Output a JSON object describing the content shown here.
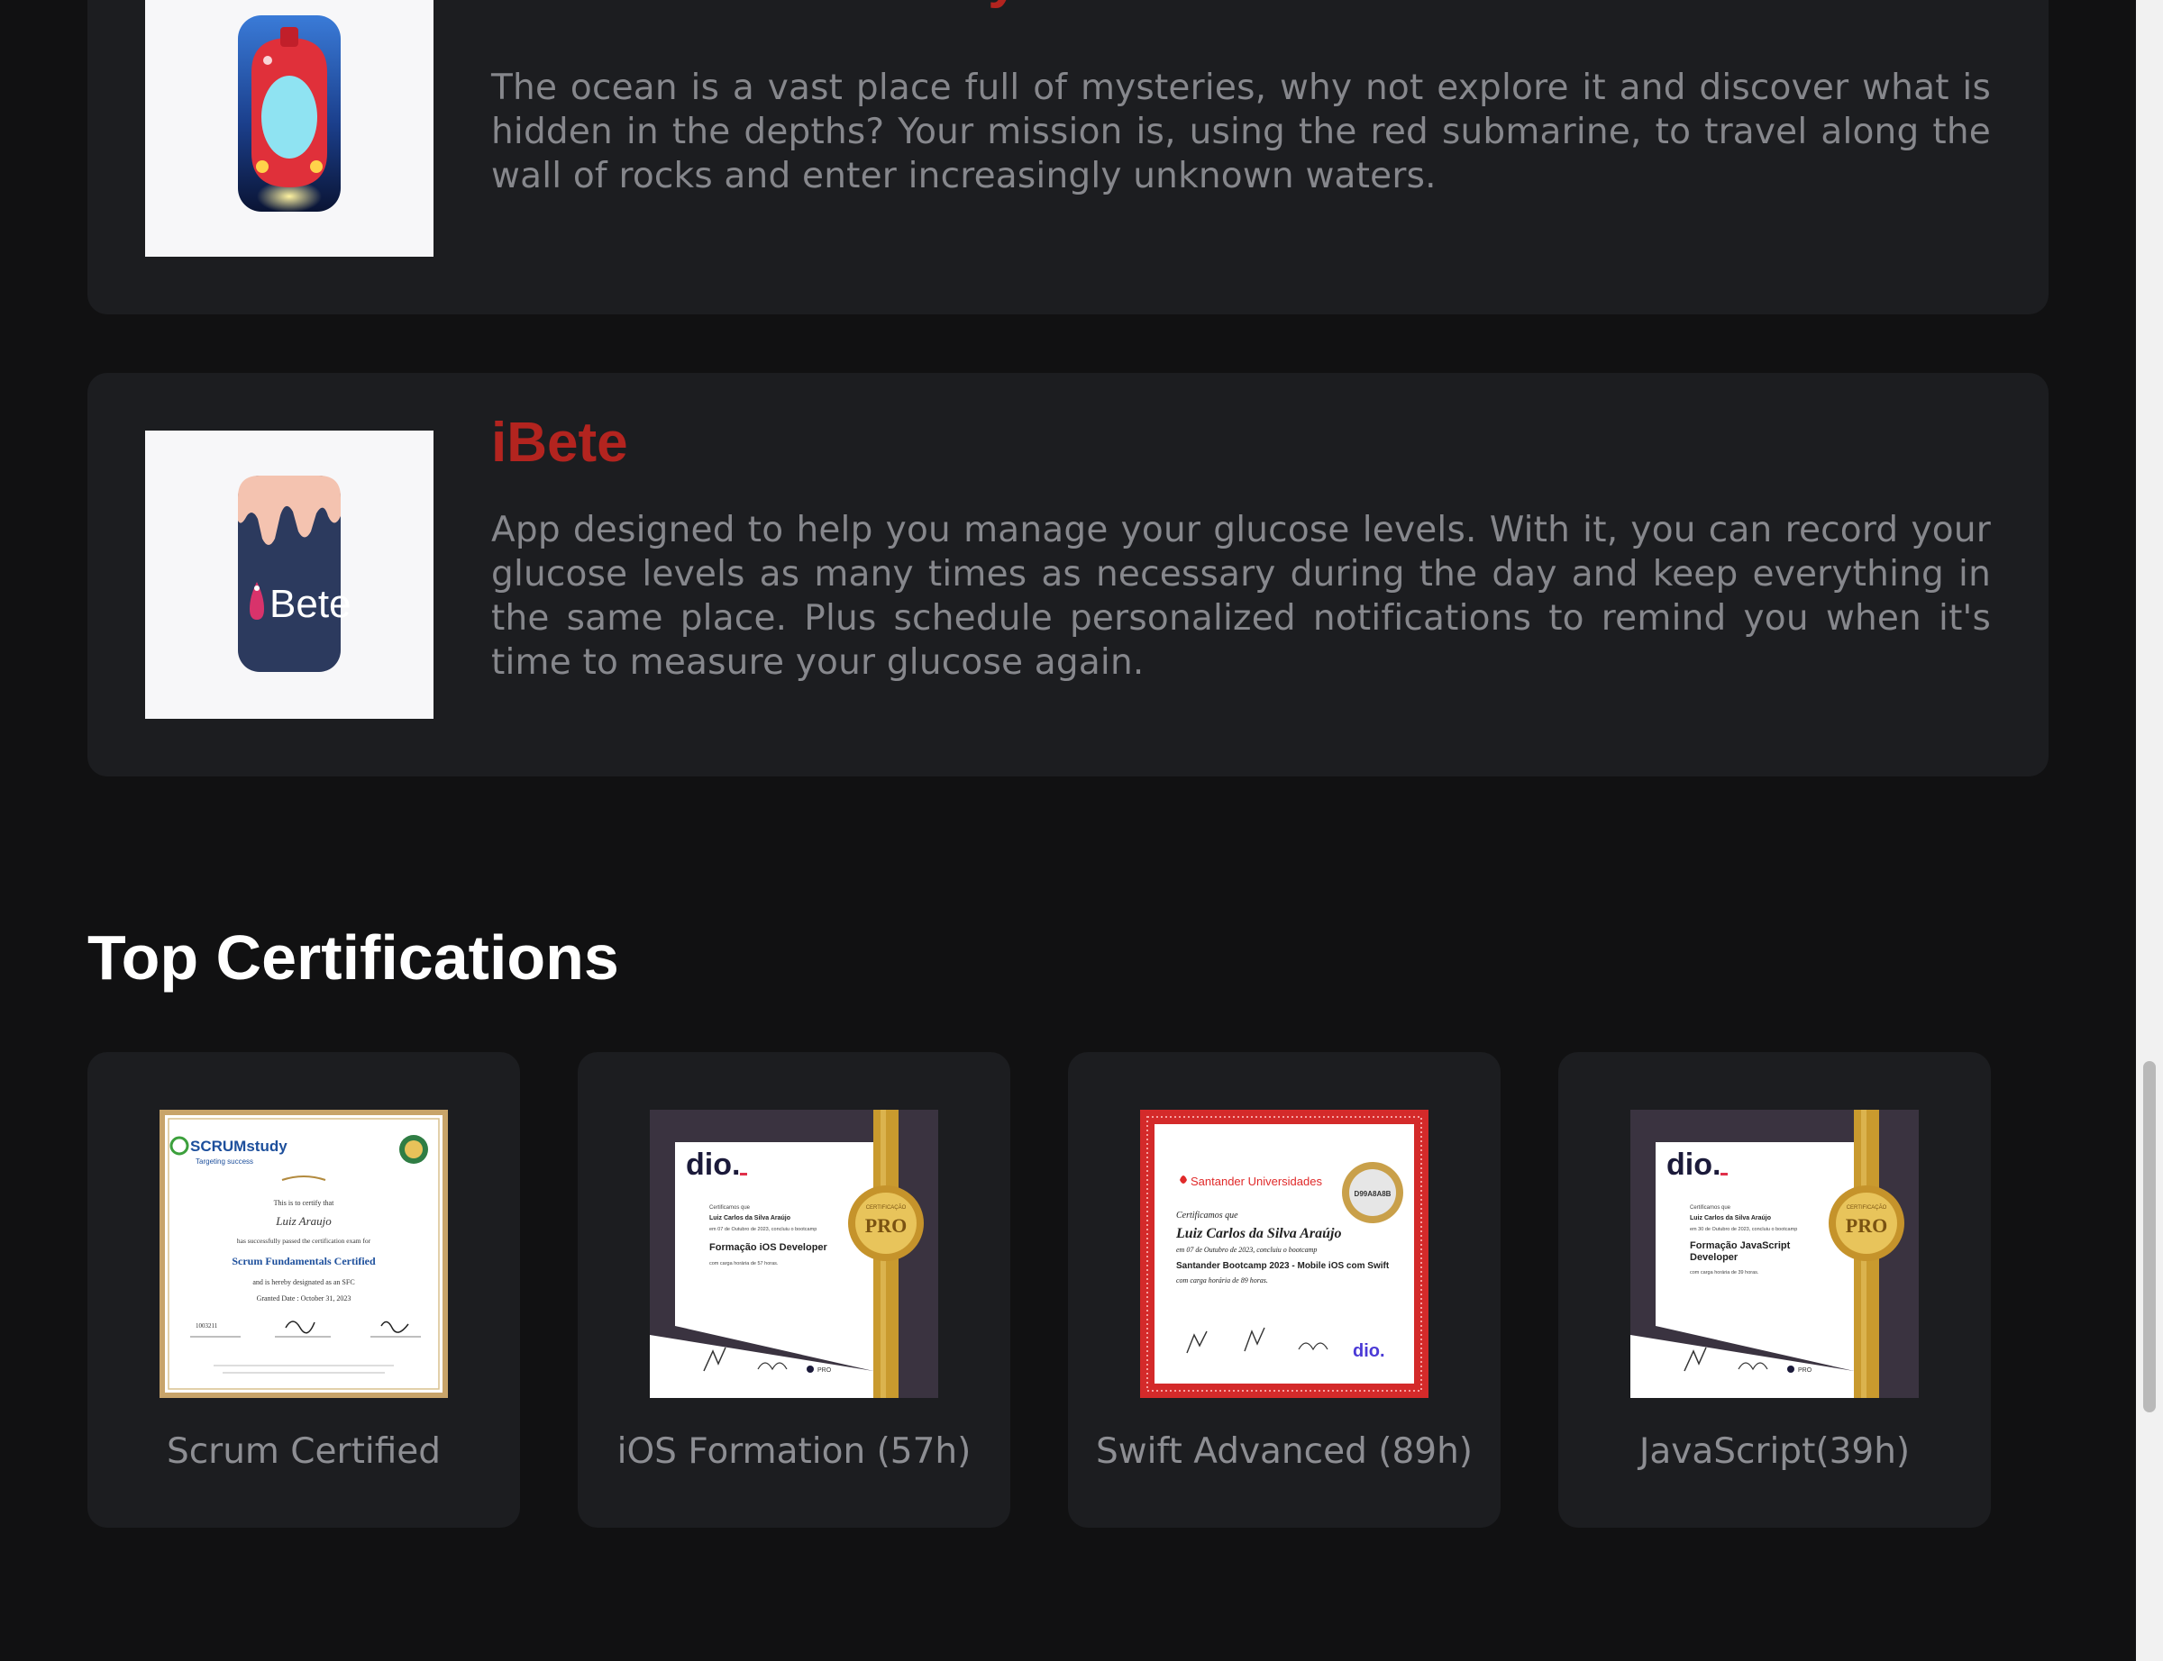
{
  "projects": [
    {
      "title": "Ultramarine: Infinity Dive",
      "description": "The ocean is a vast place full of mysteries, why not explore it and discover what is hidden in the depths? Your mission is, using the red submarine, to travel along the wall of rocks and enter increasingly unknown waters.",
      "icon": "red-submarine-app-icon"
    },
    {
      "title": "iBete",
      "description": "App designed to help you manage your glucose levels. With it, you can record your glucose levels as many times as necessary during the day and keep everything in the same place. Plus schedule personalized notifications to remind you when it's time to measure your glucose again.",
      "icon": "ibete-app-icon",
      "icon_text": "Bete"
    }
  ],
  "certifications_section": {
    "title": "Top Certifications"
  },
  "certifications": [
    {
      "label": "Scrum Certified",
      "image_text": {
        "brand": "SCRUMstudy",
        "tagline": "Targeting success",
        "line1": "This is to certify that",
        "name": "Luiz Araujo",
        "line2": "has successfully passed the certification exam for",
        "course": "Scrum Fundamentals Certified",
        "line3": "and is hereby designated as an SFC",
        "date": "Granted Date : October 31, 2023",
        "number": "1003211"
      }
    },
    {
      "label": "iOS Formation (57h)",
      "image_text": {
        "brand": "dio.",
        "certify": "Certificamos que",
        "name": "Luiz Carlos da Silva Araújo",
        "line1": "em 07 de Outubro de 2023, concluiu o bootcamp",
        "course": "Formação iOS Developer",
        "line2": "com carga horária de 57 horas.",
        "seal": "PRO",
        "seal_ring": "CERTIFICAÇÃO",
        "footer": "PRO"
      }
    },
    {
      "label": "Swift Advanced (89h)",
      "image_text": {
        "brand": "Santander Universidades",
        "seal_code": "D99A8A8B",
        "certify": "Certificamos que",
        "name": "Luiz Carlos da Silva Araújo",
        "line1": "em 07 de Outubro de 2023, concluiu o bootcamp",
        "course": "Santander Bootcamp 2023 - Mobile iOS com Swift",
        "line2": "com carga horária de 89 horas.",
        "footer": "dio."
      }
    },
    {
      "label": "JavaScript(39h)",
      "image_text": {
        "brand": "dio.",
        "certify": "Certificamos que",
        "name": "Luiz Carlos da Silva Araújo",
        "line1": "em 30 de Outubro de 2023, concluiu o bootcamp",
        "course_1": "Formação JavaScript",
        "course_2": "Developer",
        "line2": "com carga horária de 39 horas.",
        "seal": "PRO",
        "seal_ring": "CERTIFICAÇÃO",
        "footer": "PRO"
      }
    }
  ],
  "colors": {
    "background": "#111112",
    "card": "#1c1d20",
    "accent": "#b3241f",
    "body_text": "#86878c",
    "heading": "#ffffff"
  }
}
